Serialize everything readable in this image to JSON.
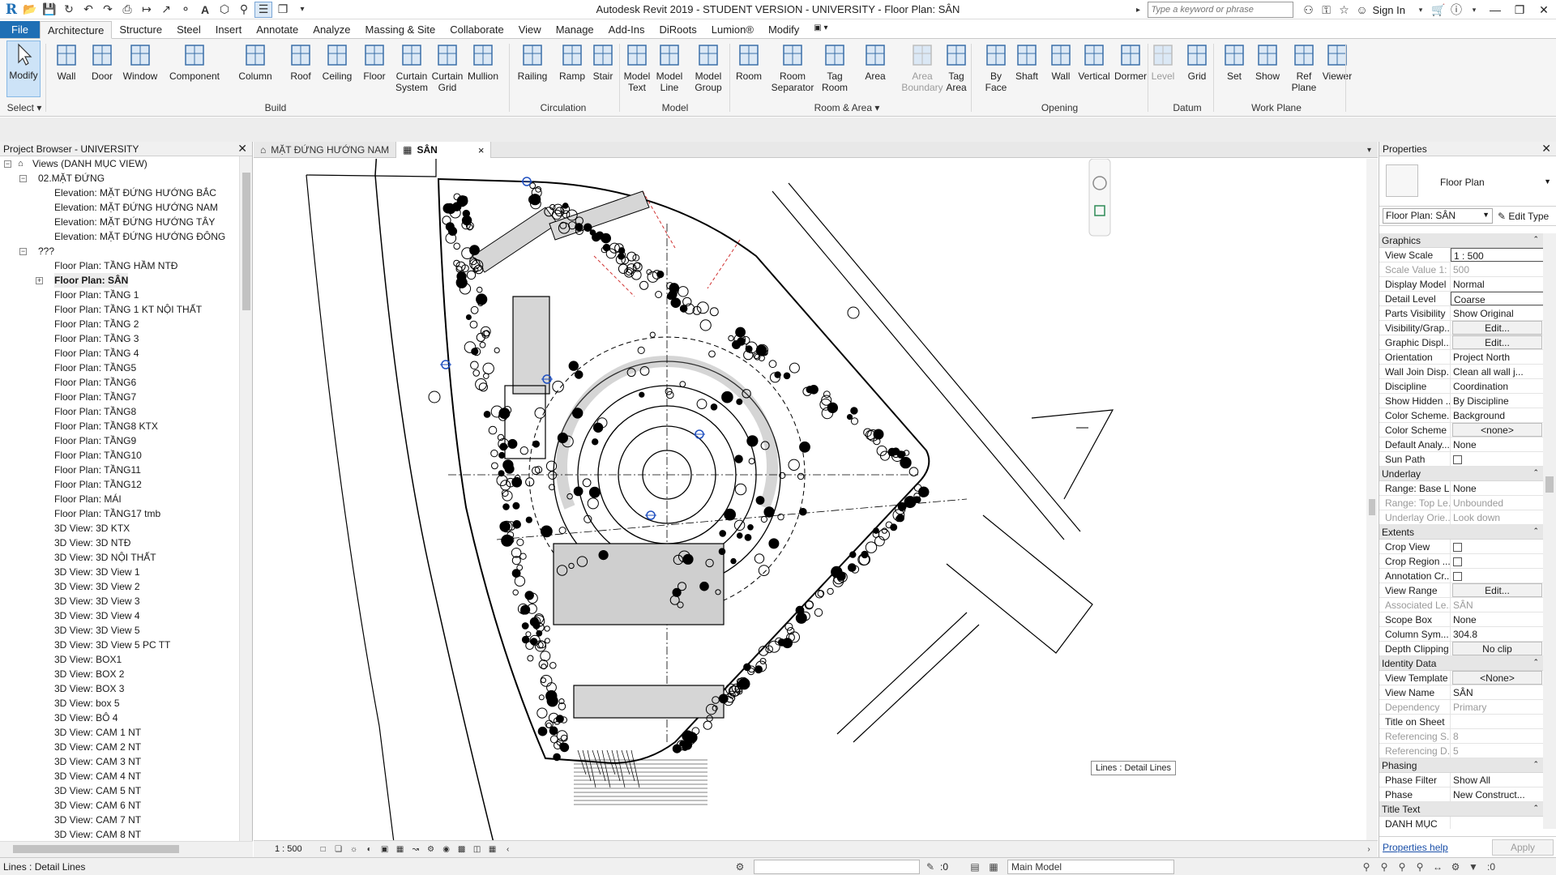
{
  "app": {
    "title": "Autodesk Revit 2019 - STUDENT VERSION - UNIVERSITY - Floor Plan: SÂN",
    "logo_letter": "R",
    "search_placeholder": "Type a keyword or phrase",
    "sign_in": "Sign In"
  },
  "ribbon_tabs": [
    "File",
    "Architecture",
    "Structure",
    "Steel",
    "Insert",
    "Annotate",
    "Analyze",
    "Massing & Site",
    "Collaborate",
    "View",
    "Manage",
    "Add-Ins",
    "DiRoots",
    "Lumion®",
    "Modify"
  ],
  "ribbon": {
    "select_label": "Select",
    "buttons": [
      {
        "id": "modify",
        "label": "Modify"
      },
      {
        "id": "wall",
        "label": "Wall"
      },
      {
        "id": "door",
        "label": "Door"
      },
      {
        "id": "window",
        "label": "Window"
      },
      {
        "id": "component",
        "label": "Component"
      },
      {
        "id": "column",
        "label": "Column"
      },
      {
        "id": "roof",
        "label": "Roof"
      },
      {
        "id": "ceiling",
        "label": "Ceiling"
      },
      {
        "id": "floor",
        "label": "Floor"
      },
      {
        "id": "curtain-system",
        "label": "Curtain\nSystem"
      },
      {
        "id": "curtain-grid",
        "label": "Curtain\nGrid"
      },
      {
        "id": "mullion",
        "label": "Mullion"
      },
      {
        "id": "railing",
        "label": "Railing"
      },
      {
        "id": "ramp",
        "label": "Ramp"
      },
      {
        "id": "stair",
        "label": "Stair"
      },
      {
        "id": "model-text",
        "label": "Model\nText"
      },
      {
        "id": "model-line",
        "label": "Model\nLine"
      },
      {
        "id": "model-group",
        "label": "Model\nGroup"
      },
      {
        "id": "room",
        "label": "Room"
      },
      {
        "id": "room-separator",
        "label": "Room\nSeparator"
      },
      {
        "id": "tag-room",
        "label": "Tag\nRoom"
      },
      {
        "id": "area",
        "label": "Area"
      },
      {
        "id": "area-boundary",
        "label": "Area\nBoundary"
      },
      {
        "id": "tag-area",
        "label": "Tag\nArea"
      },
      {
        "id": "by-face",
        "label": "By\nFace"
      },
      {
        "id": "shaft",
        "label": "Shaft"
      },
      {
        "id": "opening-wall",
        "label": "Wall"
      },
      {
        "id": "vertical",
        "label": "Vertical"
      },
      {
        "id": "dormer",
        "label": "Dormer"
      },
      {
        "id": "level",
        "label": "Level"
      },
      {
        "id": "grid",
        "label": "Grid"
      },
      {
        "id": "set",
        "label": "Set"
      },
      {
        "id": "show",
        "label": "Show"
      },
      {
        "id": "ref-plane",
        "label": "Ref\nPlane"
      },
      {
        "id": "viewer",
        "label": "Viewer"
      }
    ],
    "panels": [
      "Build",
      "Circulation",
      "Model",
      "Room & Area",
      "Opening",
      "Datum",
      "Work Plane"
    ]
  },
  "project_browser": {
    "title": "Project Browser - UNIVERSITY",
    "items": [
      "Views (DANH MỤC VIEW)",
      "02.MẶT ĐỨNG",
      "Elevation: MẶT ĐỨNG HƯỚNG BẮC",
      "Elevation: MẶT ĐỨNG HƯỚNG NAM",
      "Elevation: MẶT ĐỨNG HƯỚNG TÂY",
      "Elevation: MẶT ĐỨNG HƯỚNG ĐÔNG",
      "???",
      "Floor Plan: TẦNG HẦM NTĐ",
      "Floor Plan: SÂN",
      "Floor Plan: TẦNG 1",
      "Floor Plan: TẦNG 1 KT NỘI THẤT",
      "Floor Plan: TẦNG 2",
      "Floor Plan: TẦNG 3",
      "Floor Plan: TẦNG 4",
      "Floor Plan: TẦNG5",
      "Floor Plan: TẦNG6",
      "Floor Plan: TẦNG7",
      "Floor Plan: TẦNG8",
      "Floor Plan: TẦNG8 KTX",
      "Floor Plan: TẦNG9",
      "Floor Plan: TẦNG10",
      "Floor Plan: TẦNG11",
      "Floor Plan: TẦNG12",
      "Floor Plan: MÁI",
      "Floor Plan: TẦNG17 tmb",
      "3D View: 3D KTX",
      "3D View: 3D NTĐ",
      "3D View: 3D NỘI THẤT",
      "3D View: 3D View 1",
      "3D View: 3D View 2",
      "3D View: 3D View 3",
      "3D View: 3D View 4",
      "3D View: 3D View 5",
      "3D View: 3D View 5 PC TT",
      "3D View: BOX1",
      "3D View: BOX 2",
      "3D View: BOX 3",
      "3D View: box 5",
      "3D View: BÔ 4",
      "3D View: CAM 1 NT",
      "3D View: CAM 2 NT",
      "3D View: CAM 3 NT",
      "3D View: CAM 4 NT",
      "3D View: CAM 5 NT",
      "3D View: CAM 6 NT",
      "3D View: CAM 7 NT",
      "3D View: CAM 8 NT"
    ]
  },
  "view_tabs": [
    {
      "label": "MẶT ĐỨNG HƯỚNG NAM"
    },
    {
      "label": "SÂN",
      "close": "×"
    }
  ],
  "canvas": {
    "tooltip": "Lines : Detail Lines"
  },
  "view_bar": {
    "scale": "1 : 500"
  },
  "properties": {
    "title": "Properties",
    "type_name": "Floor Plan",
    "instance": "Floor Plan: SÂN",
    "edit_type": "Edit Type",
    "groups": [
      {
        "name": "Graphics",
        "rows": [
          {
            "k": "View Scale",
            "v": "1 : 500",
            "style": "box"
          },
          {
            "k": "Scale Value    1:",
            "v": "500",
            "style": "ro"
          },
          {
            "k": "Display Model",
            "v": "Normal"
          },
          {
            "k": "Detail Level",
            "v": "Coarse",
            "style": "box"
          },
          {
            "k": "Parts Visibility",
            "v": "Show Original"
          },
          {
            "k": "Visibility/Grap...",
            "v": "Edit...",
            "style": "btn"
          },
          {
            "k": "Graphic Displ...",
            "v": "Edit...",
            "style": "btn"
          },
          {
            "k": "Orientation",
            "v": "Project North"
          },
          {
            "k": "Wall Join Disp...",
            "v": "Clean all wall j..."
          },
          {
            "k": "Discipline",
            "v": "Coordination"
          },
          {
            "k": "Show Hidden ...",
            "v": "By Discipline"
          },
          {
            "k": "Color Scheme...",
            "v": "Background"
          },
          {
            "k": "Color Scheme",
            "v": "<none>",
            "style": "btn"
          },
          {
            "k": "Default Analy...",
            "v": "None"
          },
          {
            "k": "Sun Path",
            "v": "",
            "style": "chk"
          }
        ]
      },
      {
        "name": "Underlay",
        "rows": [
          {
            "k": "Range: Base L...",
            "v": "None"
          },
          {
            "k": "Range: Top Le...",
            "v": "Unbounded",
            "style": "ro"
          },
          {
            "k": "Underlay Orie...",
            "v": "Look down",
            "style": "ro"
          }
        ]
      },
      {
        "name": "Extents",
        "rows": [
          {
            "k": "Crop View",
            "v": "",
            "style": "chk"
          },
          {
            "k": "Crop Region ...",
            "v": "",
            "style": "chk"
          },
          {
            "k": "Annotation Cr...",
            "v": "",
            "style": "chk"
          },
          {
            "k": "View Range",
            "v": "Edit...",
            "style": "btn"
          },
          {
            "k": "Associated Le...",
            "v": "SÂN",
            "style": "ro"
          },
          {
            "k": "Scope Box",
            "v": "None"
          },
          {
            "k": "Column Sym...",
            "v": "304.8"
          },
          {
            "k": "Depth Clipping",
            "v": "No clip",
            "style": "btn"
          }
        ]
      },
      {
        "name": "Identity Data",
        "rows": [
          {
            "k": "View Template",
            "v": "<None>",
            "style": "btn"
          },
          {
            "k": "View Name",
            "v": "SÂN"
          },
          {
            "k": "Dependency",
            "v": "Primary",
            "style": "ro"
          },
          {
            "k": "Title on Sheet",
            "v": ""
          },
          {
            "k": "Referencing S...",
            "v": "8",
            "style": "ro"
          },
          {
            "k": "Referencing D...",
            "v": "5",
            "style": "ro"
          }
        ]
      },
      {
        "name": "Phasing",
        "rows": [
          {
            "k": "Phase Filter",
            "v": "Show All"
          },
          {
            "k": "Phase",
            "v": "New Construct..."
          }
        ]
      },
      {
        "name": "Title Text",
        "rows": [
          {
            "k": "DANH MỤC",
            "v": ""
          }
        ]
      }
    ],
    "help": "Properties help",
    "apply": "Apply"
  },
  "status": {
    "text": "Lines : Detail Lines",
    "zero": ":0",
    "model": "Main Model"
  },
  "colors": {
    "accent": "#1f6fb5",
    "modify_highlight": "#cde3f7",
    "drawing_lines": "#000000",
    "red_dash": "#d03030",
    "blue_marker": "#2050c0"
  }
}
